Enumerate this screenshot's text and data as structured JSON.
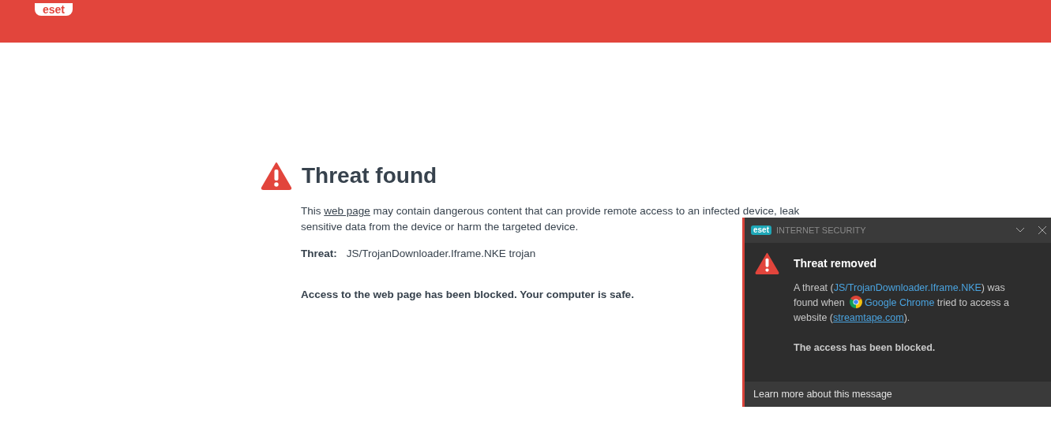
{
  "header": {
    "logo": "eset"
  },
  "threat_page": {
    "title": "Threat found",
    "description": [
      {
        "kind": "text",
        "text": "This "
      },
      {
        "kind": "link",
        "text": "web page"
      },
      {
        "kind": "text",
        "text": " may contain dangerous content that can provide remote access to an infected device, leak sensitive data from the device or harm the targeted device."
      }
    ],
    "threat_label": "Threat:",
    "threat_value": "JS/TrojanDownloader.Iframe.NKE trojan",
    "status": "Access to the web page has been blocked. Your computer is safe."
  },
  "notification": {
    "brand": "eset",
    "product": "INTERNET SECURITY",
    "title": "Threat removed",
    "message": [
      {
        "kind": "text",
        "text": "A threat ("
      },
      {
        "kind": "link",
        "text": "JS/TrojanDownloader.Iframe.NKE"
      },
      {
        "kind": "text",
        "text": ") was found when "
      },
      {
        "kind": "app",
        "text": "Google Chrome"
      },
      {
        "kind": "text",
        "text": "  tried to access a website ("
      },
      {
        "kind": "url",
        "text": "streamtape.com"
      },
      {
        "kind": "text",
        "text": ")."
      }
    ],
    "status": "The access has been blocked.",
    "footer_link": "Learn more about this message"
  }
}
